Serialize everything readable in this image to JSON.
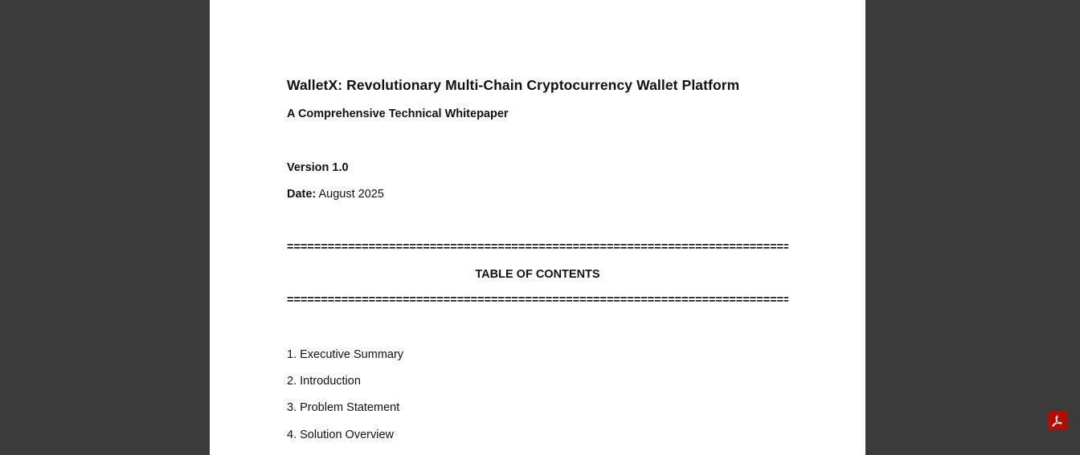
{
  "document": {
    "title": "WalletX: Revolutionary Multi-Chain Cryptocurrency Wallet Platform",
    "subtitle": "A Comprehensive Technical Whitepaper",
    "version": "Version 1.0",
    "date_label": "Date:",
    "date_value": " August 2025",
    "rule": "==========================================================================",
    "toc_heading": "TABLE OF CONTENTS",
    "toc_items": [
      "1. Executive Summary",
      "2. Introduction",
      "3. Problem Statement",
      "4. Solution Overview"
    ]
  },
  "viewer": {
    "pdf_icon": "adobe-acrobat-icon",
    "background_color": "#3b3b3b",
    "icon_color": "#b30b00"
  }
}
